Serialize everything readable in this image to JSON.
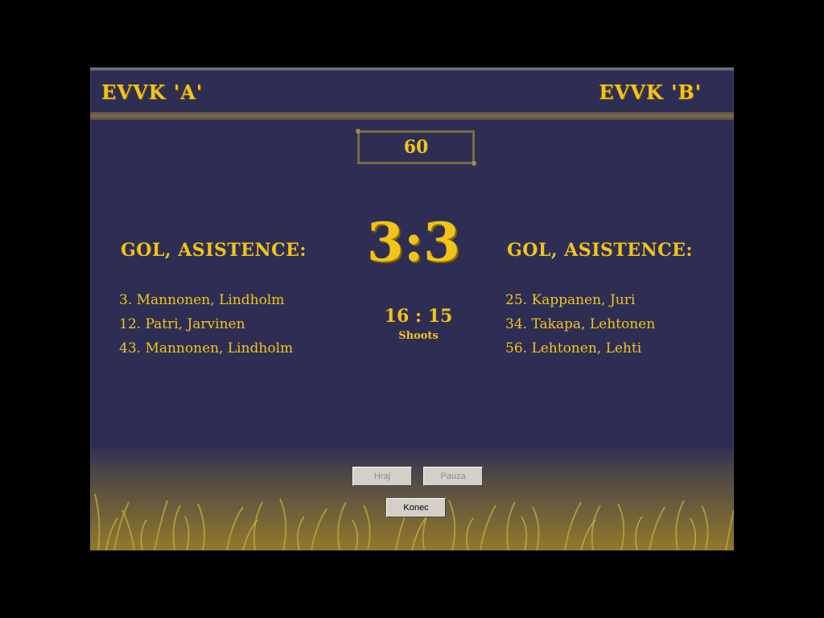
{
  "teams": {
    "home": "EVVK 'A'",
    "away": "EVVK 'B'"
  },
  "timer": "60",
  "score": "3:3",
  "goals_heading": {
    "home": "GOL, ASISTENCE:",
    "away": "GOL, ASISTENCE:"
  },
  "goals": {
    "home": [
      "3. Mannonen, Lindholm",
      "12. Patri, Jarvinen",
      "43. Mannonen, Lindholm"
    ],
    "away": [
      "25. Kappanen, Juri",
      "34. Takapa, Lehtonen",
      "56. Lehtonen, Lehti"
    ]
  },
  "shoots": {
    "value": "16 : 15",
    "label": "Shoots"
  },
  "buttons": {
    "play": "Hraj",
    "pause": "Pauza",
    "end": "Konec"
  },
  "colors": {
    "background": "#2e2e54",
    "text": "#f0c419",
    "frame": "#000000"
  }
}
